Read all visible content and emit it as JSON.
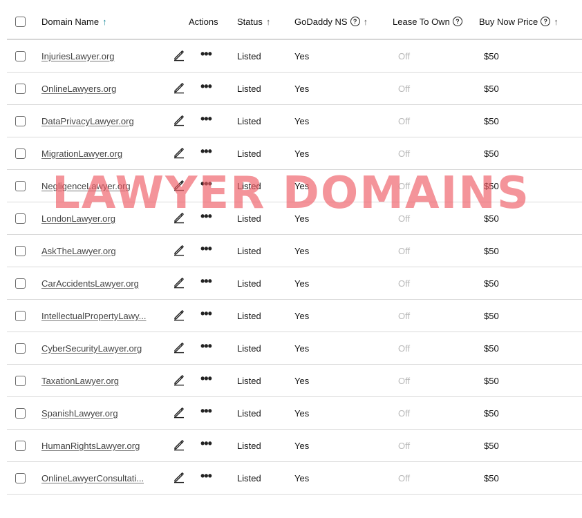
{
  "header": {
    "domain_name": "Domain Name",
    "actions": "Actions",
    "status": "Status",
    "godaddy_ns": "GoDaddy NS",
    "lease_to_own": "Lease To Own",
    "buy_now_price": "Buy Now Price",
    "sort_up": "↑",
    "help": "?"
  },
  "rows": [
    {
      "domain": "InjuriesLawyer.org",
      "status": "Listed",
      "ns": "Yes",
      "lease": "Off",
      "price": "$50"
    },
    {
      "domain": "OnlineLawyers.org",
      "status": "Listed",
      "ns": "Yes",
      "lease": "Off",
      "price": "$50"
    },
    {
      "domain": "DataPrivacyLawyer.org",
      "status": "Listed",
      "ns": "Yes",
      "lease": "Off",
      "price": "$50"
    },
    {
      "domain": "MigrationLawyer.org",
      "status": "Listed",
      "ns": "Yes",
      "lease": "Off",
      "price": "$50"
    },
    {
      "domain": "NegligenceLawyer.org",
      "status": "Listed",
      "ns": "Yes",
      "lease": "Off",
      "price": "$50"
    },
    {
      "domain": "LondonLawyer.org",
      "status": "Listed",
      "ns": "Yes",
      "lease": "Off",
      "price": "$50"
    },
    {
      "domain": "AskTheLawyer.org",
      "status": "Listed",
      "ns": "Yes",
      "lease": "Off",
      "price": "$50"
    },
    {
      "domain": "CarAccidentsLawyer.org",
      "status": "Listed",
      "ns": "Yes",
      "lease": "Off",
      "price": "$50"
    },
    {
      "domain": "IntellectualPropertyLawy...",
      "status": "Listed",
      "ns": "Yes",
      "lease": "Off",
      "price": "$50"
    },
    {
      "domain": "CyberSecurityLawyer.org",
      "status": "Listed",
      "ns": "Yes",
      "lease": "Off",
      "price": "$50"
    },
    {
      "domain": "TaxationLawyer.org",
      "status": "Listed",
      "ns": "Yes",
      "lease": "Off",
      "price": "$50"
    },
    {
      "domain": "SpanishLawyer.org",
      "status": "Listed",
      "ns": "Yes",
      "lease": "Off",
      "price": "$50"
    },
    {
      "domain": "HumanRightsLawyer.org",
      "status": "Listed",
      "ns": "Yes",
      "lease": "Off",
      "price": "$50"
    },
    {
      "domain": "OnlineLawyerConsultati...",
      "status": "Listed",
      "ns": "Yes",
      "lease": "Off",
      "price": "$50"
    }
  ],
  "watermark": "LAWYER DOMAINS",
  "icons": {
    "edit": "pencil-edit-icon",
    "more": "more-actions-icon",
    "checkbox": "checkbox",
    "help": "help-circle-icon",
    "sort": "sort-arrow-icon"
  },
  "colors": {
    "sort_active": "#1a8a9a",
    "watermark": "#ee5a64",
    "off_text": "#b8b8b8"
  }
}
